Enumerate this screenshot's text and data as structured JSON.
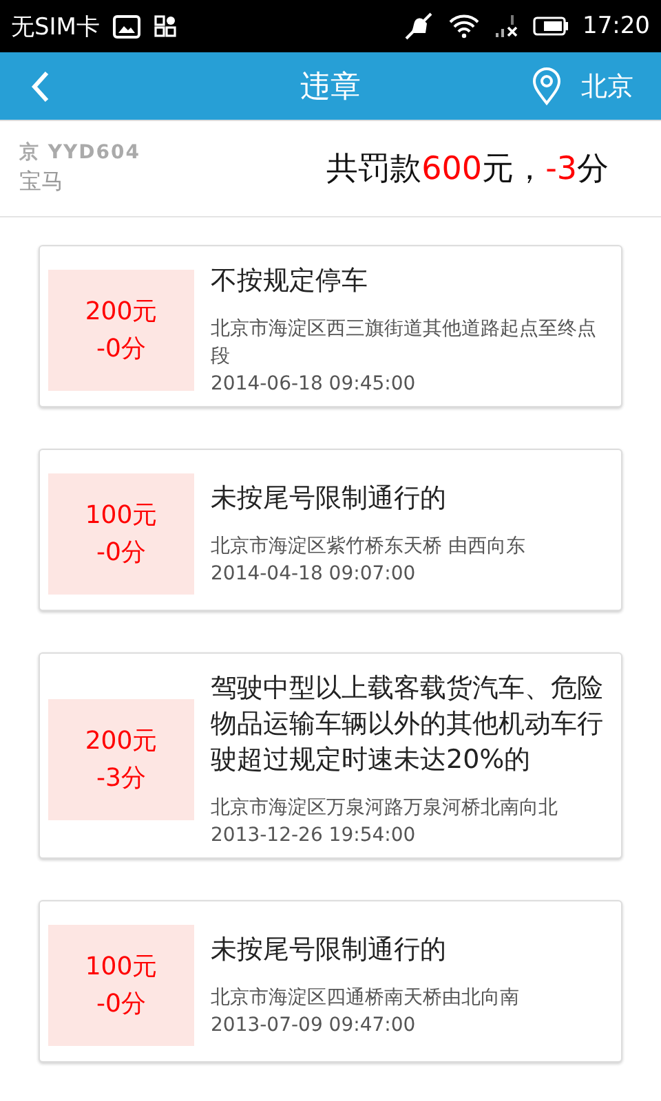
{
  "status_bar": {
    "carrier": "无SIM卡",
    "time": "17:20"
  },
  "header": {
    "title": "违章",
    "city": "北京"
  },
  "vehicle": {
    "plate": "京 YYD604",
    "model": "宝马"
  },
  "summary": [
    {
      "text": "共罚款",
      "highlight": false
    },
    {
      "text": "600",
      "highlight": true
    },
    {
      "text": "元，",
      "highlight": false
    },
    {
      "text": "-3",
      "highlight": true
    },
    {
      "text": "分",
      "highlight": false
    }
  ],
  "violations": [
    {
      "fine": "200元",
      "points": "-0分",
      "title": "不按规定停车",
      "location": "北京市海淀区西三旗街道其他道路起点至终点段",
      "time": "2014-06-18 09:45:00"
    },
    {
      "fine": "100元",
      "points": "-0分",
      "title": "未按尾号限制通行的",
      "location": "北京市海淀区紫竹桥东天桥 由西向东",
      "time": "2014-04-18 09:07:00"
    },
    {
      "fine": "200元",
      "points": "-3分",
      "title": "驾驶中型以上载客载货汽车、危险物品运输车辆以外的其他机动车行驶超过规定时速未达20%的",
      "location": "北京市海淀区万泉河路万泉河桥北南向北",
      "time": "2013-12-26 19:54:00"
    },
    {
      "fine": "100元",
      "points": "-0分",
      "title": "未按尾号限制通行的",
      "location": "北京市海淀区四通桥南天桥由北向南",
      "time": "2013-07-09 09:47:00"
    }
  ]
}
